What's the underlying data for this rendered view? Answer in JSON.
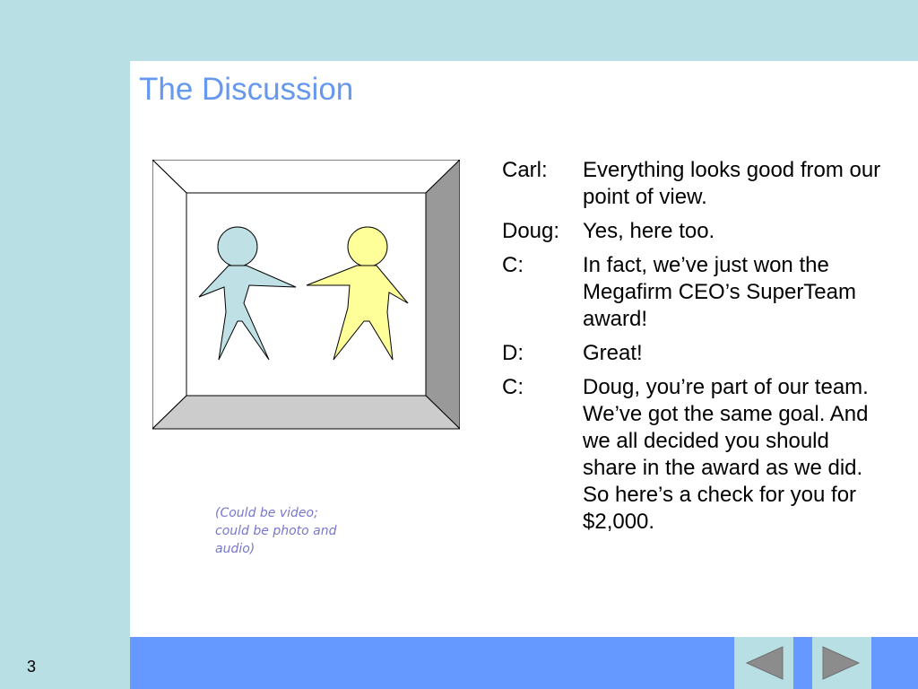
{
  "slide": {
    "title": "The Discussion",
    "number": "3",
    "caption": "(Could be video; could be photo and audio)"
  },
  "dialogue": [
    {
      "speaker": "Carl:",
      "text": "Everything looks good from our point of view."
    },
    {
      "speaker": "Doug:",
      "text": "Yes, here too."
    },
    {
      "speaker": "C:",
      "text": "In fact, we’ve just won the Megafirm CEO’s SuperTeam award!"
    },
    {
      "speaker": "D:",
      "text": "Great!"
    },
    {
      "speaker": "C:",
      "text": "Doug, you’re part of our team.  We’ve got the same goal.  And we all decided you should share in the award as we did.  So here’s a check for you for $2,000."
    }
  ],
  "navigation": {
    "prev_icon": "triangle-left-icon",
    "next_icon": "triangle-right-icon"
  },
  "colors": {
    "background": "#b8dfe3",
    "title": "#6699ee",
    "bottom_bar": "#6699ff",
    "figure_blue": "#bfe0e4",
    "figure_yellow": "#ffff99"
  }
}
